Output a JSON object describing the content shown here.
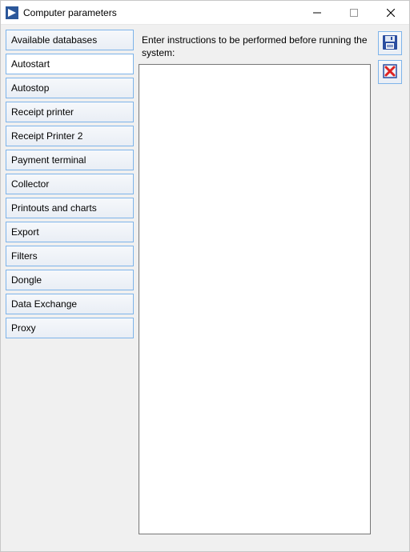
{
  "window": {
    "title": "Computer parameters"
  },
  "nav": {
    "items": [
      {
        "label": "Available databases"
      },
      {
        "label": "Autostart"
      },
      {
        "label": "Autostop"
      },
      {
        "label": "Receipt printer"
      },
      {
        "label": "Receipt Printer 2"
      },
      {
        "label": "Payment terminal"
      },
      {
        "label": "Collector"
      },
      {
        "label": "Printouts and charts"
      },
      {
        "label": "Export"
      },
      {
        "label": "Filters"
      },
      {
        "label": "Dongle"
      },
      {
        "label": "Data Exchange"
      },
      {
        "label": "Proxy"
      }
    ],
    "active_index": 1
  },
  "main": {
    "prompt": "Enter instructions to be performed before running the system:",
    "editor_value": ""
  },
  "actions": {
    "save_title": "Save",
    "delete_title": "Delete"
  }
}
